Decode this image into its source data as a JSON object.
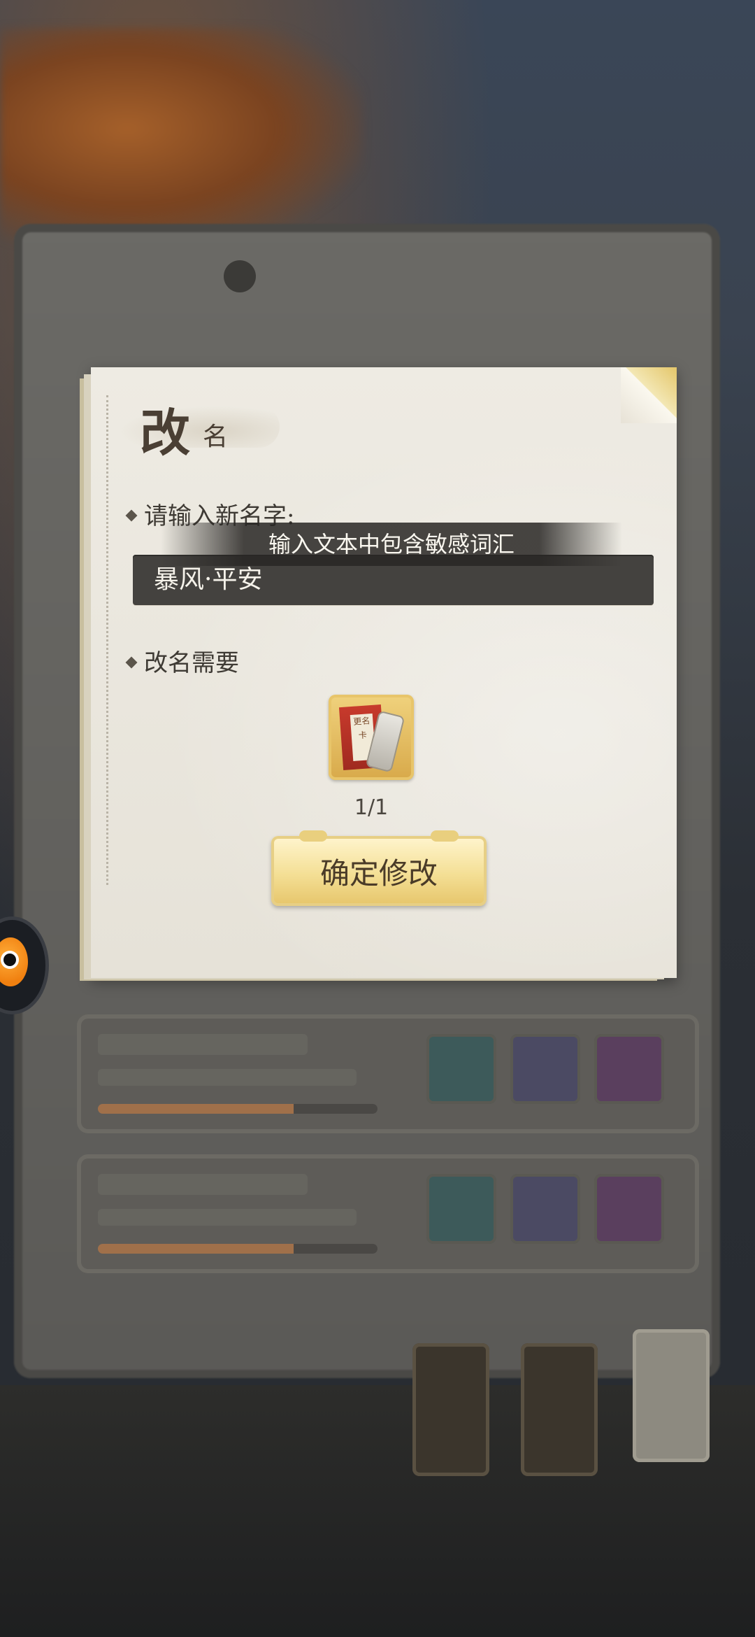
{
  "dialog": {
    "title_big": "改",
    "title_small": "名",
    "new_name_label": "请输入新名字:",
    "name_value": "暴风·平安",
    "warning_toast": "输入文本中包含敏感词汇",
    "requirement_label": "改名需要",
    "item": {
      "label": "更名卡",
      "count": "1/1"
    },
    "confirm_label": "确定修改"
  },
  "colors": {
    "input_bg": "#44423f",
    "button_gold": "#f4df95",
    "paper": "#eeebe3"
  },
  "icons": [
    "rename-card-icon",
    "diamond-bullet-icon",
    "mascot-icon"
  ]
}
